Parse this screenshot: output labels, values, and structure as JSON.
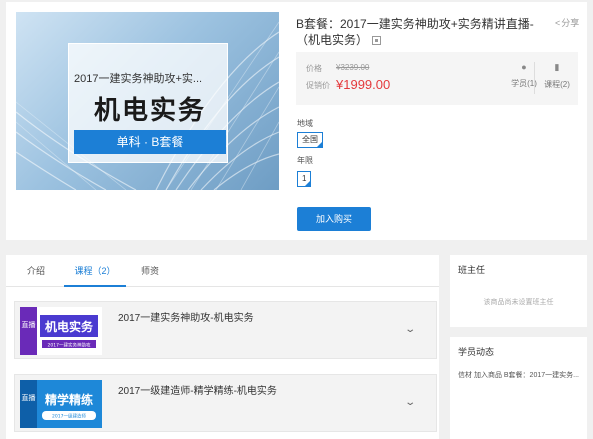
{
  "product": {
    "title": "B套餐：2017一建实务神助攻+实务精讲直播-（机电实务）",
    "share_label": "分享",
    "hero": {
      "subtitle": "2017一建实务神助攻+实...",
      "title": "机电实务",
      "band": "单科 · B套餐"
    },
    "price": {
      "orig_label": "价格",
      "orig_value": "¥3239.00",
      "sale_label": "促销价",
      "sale_value": "¥1999.00"
    },
    "stats": [
      {
        "label": "学员(1)",
        "icon": "user-icon"
      },
      {
        "label": "课程(2)",
        "icon": "book-icon"
      }
    ],
    "options": [
      {
        "label": "地域",
        "value": "全国"
      },
      {
        "label": "年限",
        "value": "1"
      }
    ],
    "buy_label": "加入购买"
  },
  "tabs": [
    {
      "label": "介绍",
      "active": false
    },
    {
      "label": "课程（2）",
      "active": true
    },
    {
      "label": "师资",
      "active": false
    }
  ],
  "courses": [
    {
      "name": "2017一建实务神助攻-机电实务",
      "thumb_badge": "直播",
      "thumb_title": "机电实务",
      "thumb_sub": "2017一建实务神助攻",
      "thumb_bg": "#ffffff",
      "thumb_accent": "#6a2ab8"
    },
    {
      "name": "2017一级建造师-精学精练-机电实务",
      "thumb_badge": "直播",
      "thumb_title": "精学精练",
      "thumb_sub": "2017一级建造师",
      "thumb_bg": "#1e88d8",
      "thumb_accent": "#0e5fa8"
    }
  ],
  "sidebar": {
    "teacher_head": "班主任",
    "teacher_empty": "该商品尚未设置班主任",
    "feed_head": "学员动态",
    "feed_item": "信材 加入商品 B套餐：2017一建实务..."
  },
  "colors": {
    "accent": "#1c7fd6",
    "sale": "#e4393c"
  }
}
